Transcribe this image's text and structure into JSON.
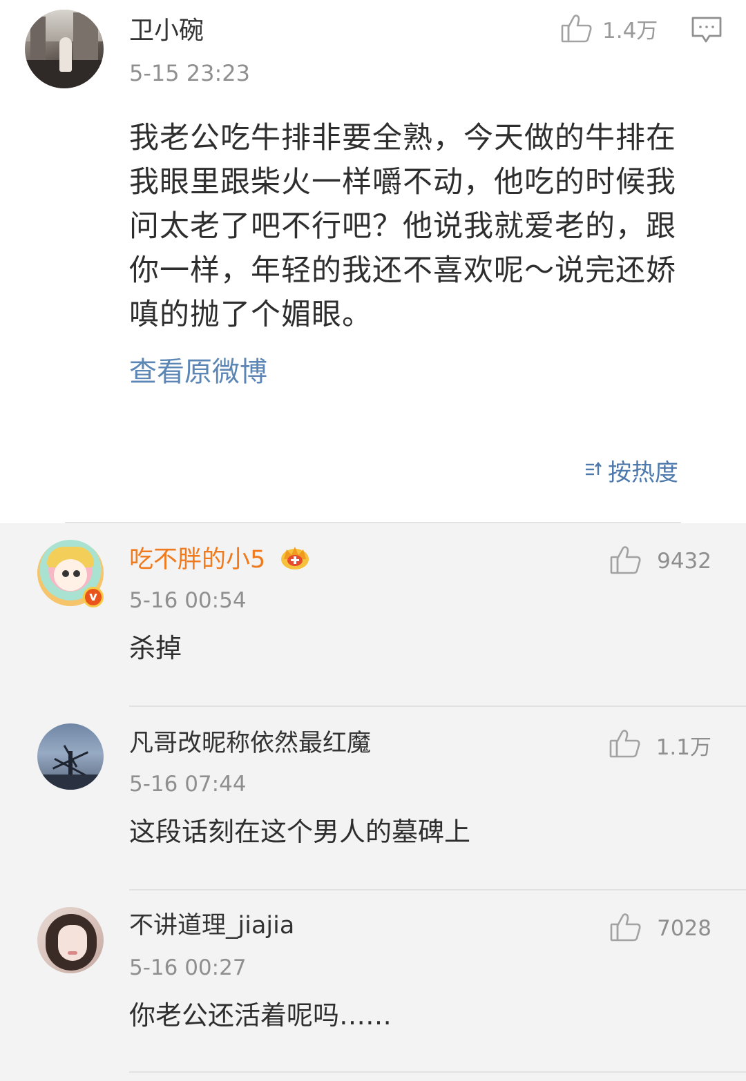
{
  "post": {
    "author": "卫小碗",
    "time": "5-15 23:23",
    "likes": "1.4万",
    "text": "我老公吃牛排非要全熟，今天做的牛排在我眼里跟柴火一样嚼不动，他吃的时候我问太老了吧不行吧？他说我就爱老的，跟你一样，年轻的我还不喜欢呢～说完还娇嗔的抛了个媚眼。",
    "view_original": "查看原微博",
    "sort_label": "按热度"
  },
  "comments": [
    {
      "name": "吃不胖的小5",
      "time": "5-16 00:54",
      "text": "杀掉",
      "likes": "9432"
    },
    {
      "name": "凡哥改昵称依然最红魔",
      "time": "5-16 07:44",
      "text": "这段话刻在这个男人的墓碑上",
      "likes": "1.1万"
    },
    {
      "name": "不讲道理_jiajia",
      "time": "5-16 00:27",
      "text": "你老公还活着呢吗……",
      "likes": "7028"
    }
  ],
  "colors": {
    "name_vip": "#f07a1e",
    "link": "#5b86b5",
    "muted": "#8f8f8f",
    "comment_bg": "#f3f3f3"
  },
  "icons": [
    "thumbs-up-icon",
    "comment-icon",
    "sort-icon",
    "crown-icon",
    "verified-badge-icon"
  ]
}
